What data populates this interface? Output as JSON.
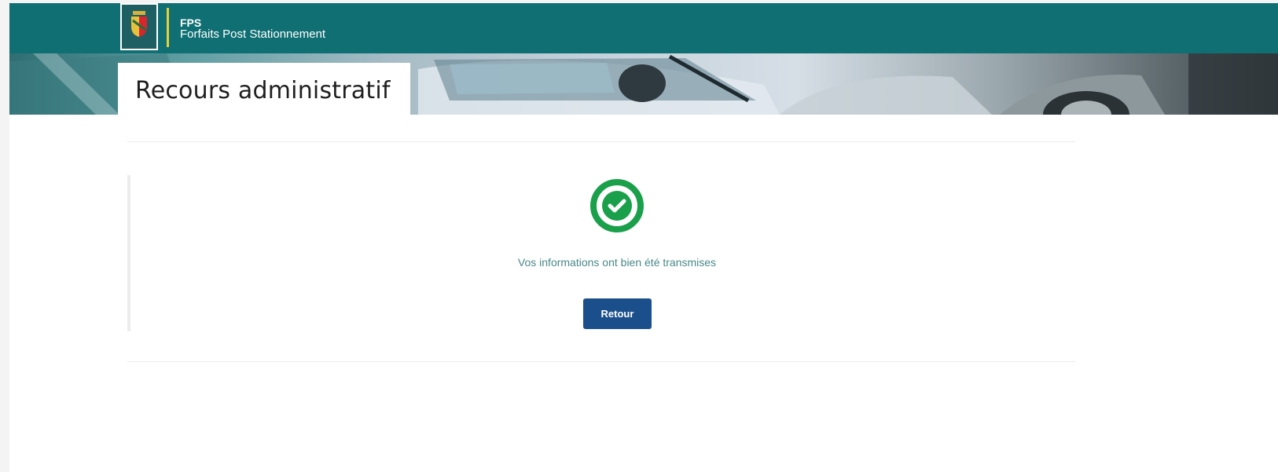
{
  "header": {
    "brand_title": "FPS",
    "brand_subtitle": "Forfaits Post Stationnement",
    "logo_icon": "coat-of-arms-icon",
    "accent_color": "#106f73",
    "separator_color": "#e7cf3a"
  },
  "banner": {
    "page_title": "Recours administratif"
  },
  "confirmation": {
    "icon": "check-circle-icon",
    "icon_color": "#1aa04b",
    "message": "Vos informations ont bien été transmises",
    "button_label": "Retour",
    "button_color": "#1b4f8c"
  }
}
